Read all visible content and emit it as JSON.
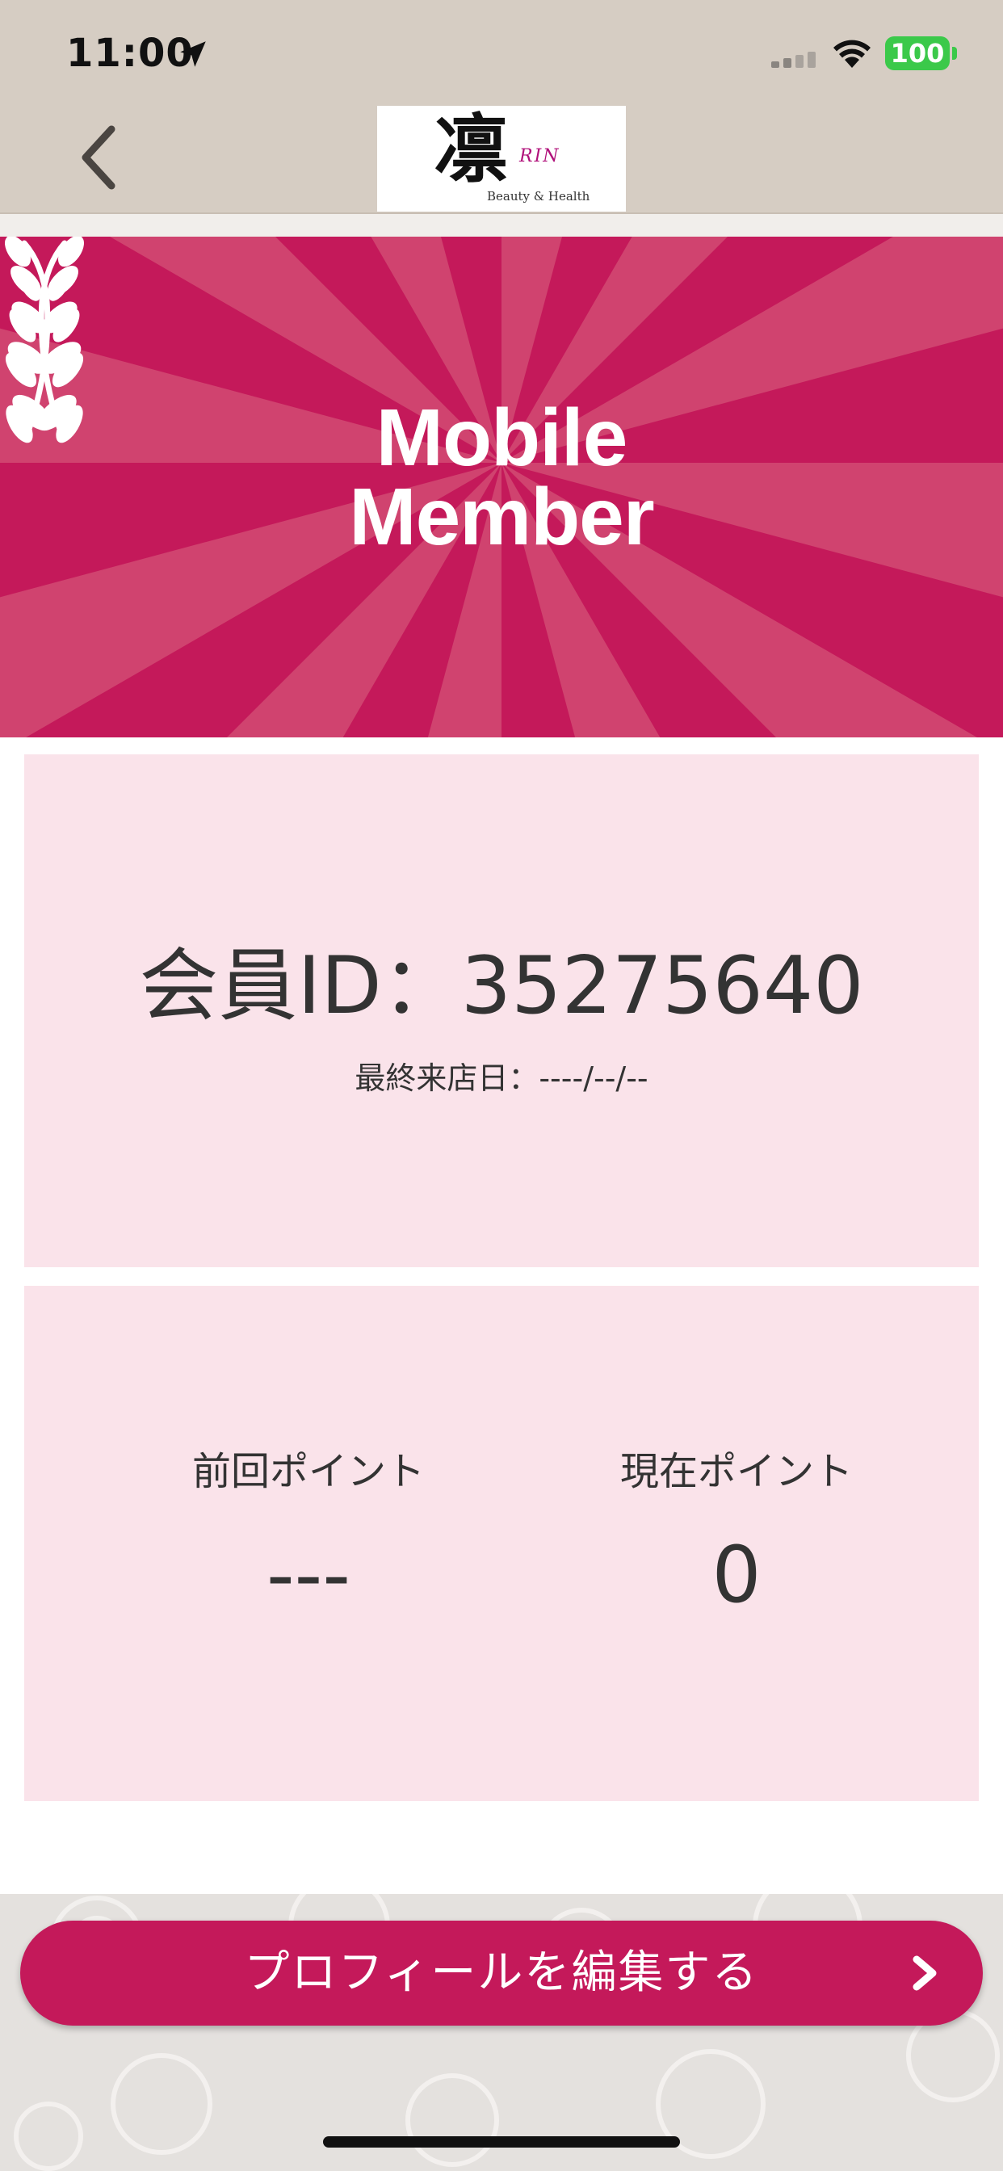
{
  "status_bar": {
    "time": "11:00",
    "battery": "100"
  },
  "nav": {
    "back_icon": "chevron-left-icon",
    "logo": {
      "kanji": "凛",
      "brand": "RIN",
      "tagline": "Beauty & Health"
    }
  },
  "banner": {
    "title": "Mobile Member",
    "background_color": "#c4195a",
    "ray_color": "#d0436f"
  },
  "member_card": {
    "member_id": "会員ID：35275640",
    "last_visit": "最終来店日：----/--/--"
  },
  "points_card": {
    "previous_label": "前回ポイント",
    "previous_value": "---",
    "current_label": "現在ポイント",
    "current_value": "0"
  },
  "actions": {
    "edit_profile_label": "プロフィールを編集する",
    "edit_profile_icon": "chevron-right-icon"
  },
  "colors": {
    "accent": "#c4195a",
    "card_bg": "#fae3ea",
    "topbar_bg": "#d6cdc3"
  }
}
